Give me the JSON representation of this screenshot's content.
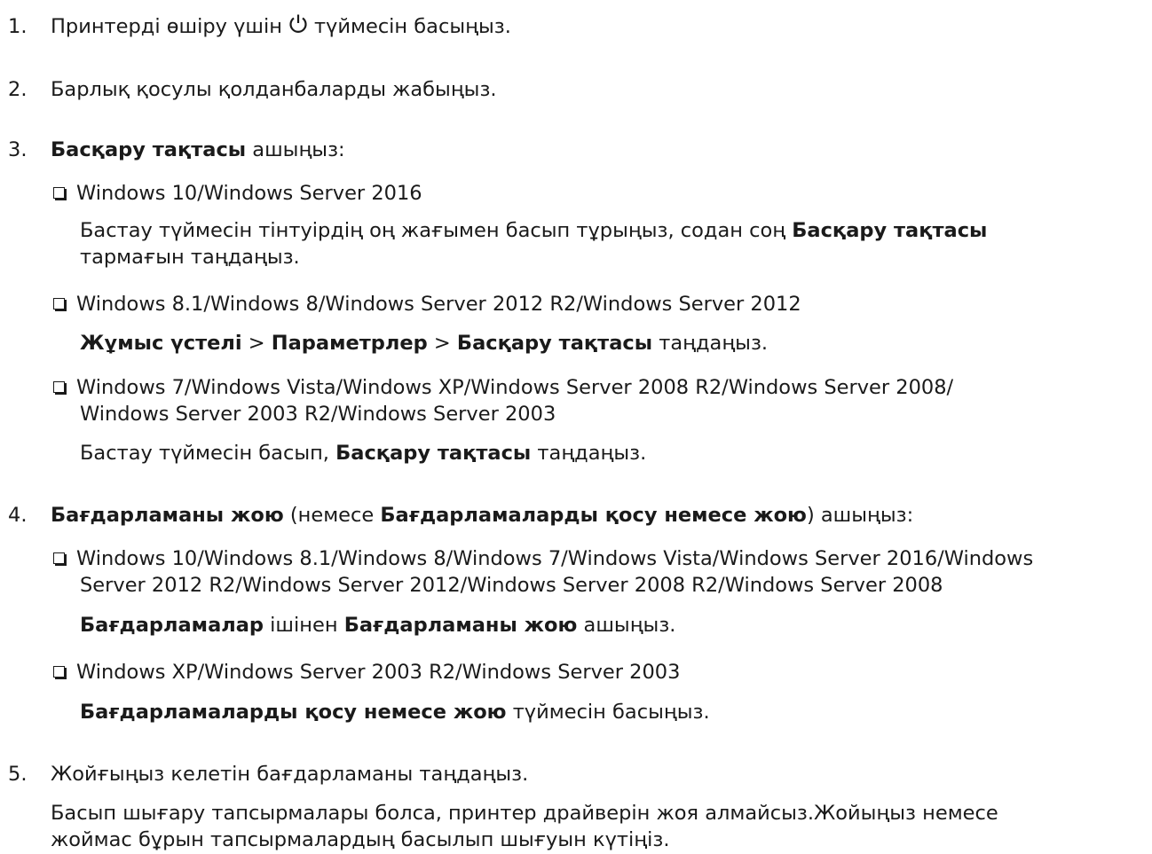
{
  "steps": [
    {
      "num": "1.",
      "before": "Принтерді өшіру үшін",
      "icon": "power-icon",
      "after": "түймесін басыңыз."
    },
    {
      "num": "2.",
      "text": "Барлық қосулы қолданбаларды жабыңыз."
    },
    {
      "num": "3.",
      "bold": "Басқару тақтасы",
      "after": "ашыңыз:",
      "options": [
        {
          "label": "Windows 10/Windows Server 2016",
          "desc_l1": "Бастау түймесін тінтуірдің оң жағымен басып тұрыңыз, содан соң",
          "desc_l1_bold": "Басқару тақтасы",
          "desc_l2": "тармағын таңдаңыз."
        },
        {
          "label": "Windows 8.1/Windows 8/Windows Server 2012 R2/Windows Server 2012",
          "desc_b1": "Жұмыс үстелі",
          "desc_sep1": ">",
          "desc_b2": "Параметрлер",
          "desc_sep2": ">",
          "desc_b3": "Басқару тақтасы",
          "desc_after": "таңдаңыз."
        },
        {
          "label_l1": "Windows 7/Windows Vista/Windows XP/Windows Server 2008 R2/Windows Server 2008/",
          "label_l2": "Windows Server 2003 R2/Windows Server 2003",
          "desc_before": "Бастау түймесін басып,",
          "desc_bold": "Басқару тақтасы",
          "desc_after": "таңдаңыз."
        }
      ]
    },
    {
      "num": "4.",
      "bold1": "Бағдарламаны жою",
      "mid1": "(немесе",
      "bold2": "Бағдарламаларды қосу немесе жою",
      "after": ") ашыңыз:",
      "options": [
        {
          "label_l1": "Windows 10/Windows 8.1/Windows 8/Windows 7/Windows Vista/Windows Server 2016/Windows",
          "label_l2": "Server 2012 R2/Windows Server 2012/Windows Server 2008 R2/Windows Server 2008",
          "desc_b1": "Бағдарламалар",
          "desc_mid": "ішінен",
          "desc_b2": "Бағдарламаны жою",
          "desc_after": "ашыңыз."
        },
        {
          "label": "Windows XP/Windows Server 2003 R2/Windows Server 2003",
          "desc_bold": "Бағдарламаларды қосу немесе жою",
          "desc_after": "түймесін басыңыз."
        }
      ]
    },
    {
      "num": "5.",
      "text": "Жойғыңыз келетін бағдарламаны таңдаңыз.",
      "note_l1": "Басып шығару тапсырмалары болса, принтер драйверін жоя алмайсыз.Жойыңыз немесе",
      "note_l2": "жоймас бұрын тапсырмалардың басылып шығуын күтіңіз."
    }
  ]
}
